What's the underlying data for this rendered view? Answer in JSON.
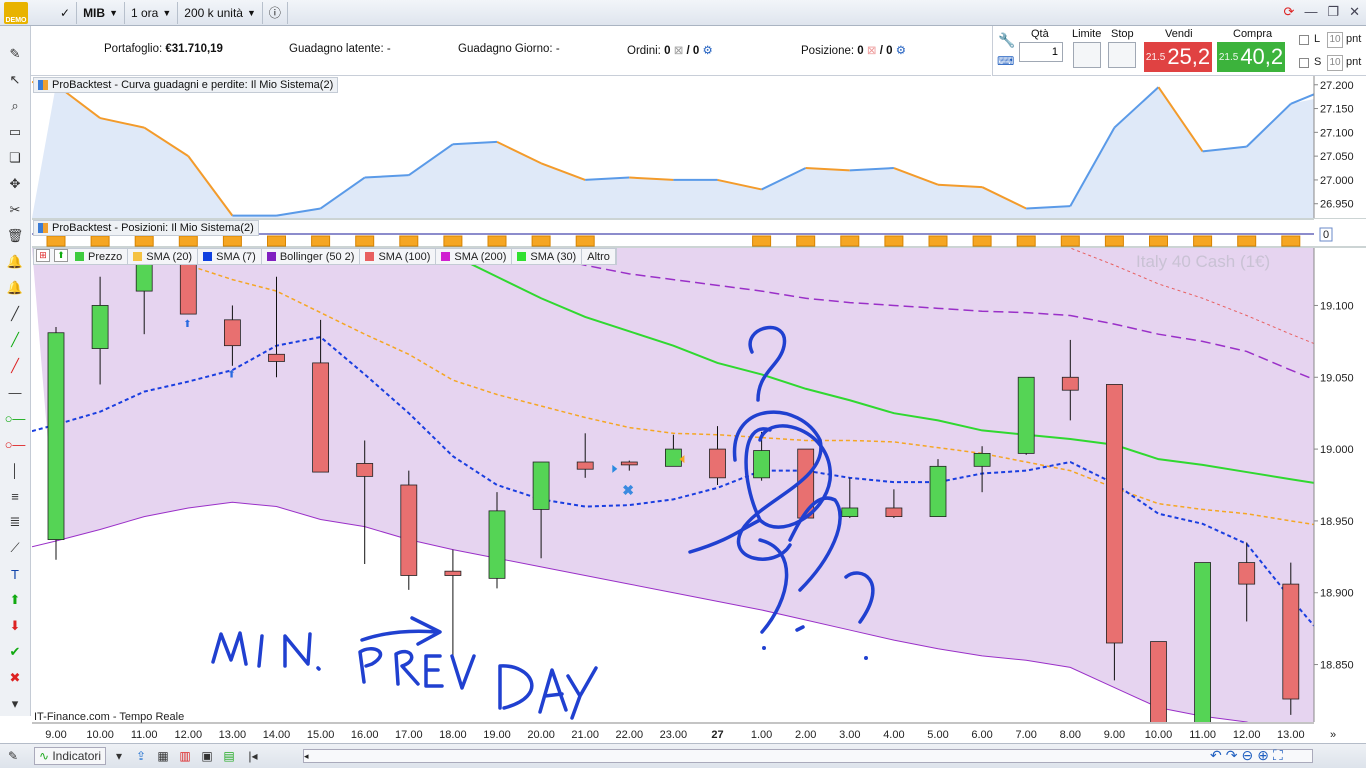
{
  "toolbar": {
    "demo_label": "DEMO",
    "instrument": "MIB",
    "timeframe": "1 ora",
    "units": "200 k unità",
    "info_icon": "info-icon"
  },
  "account": {
    "portfolio_label": "Portafoglio:",
    "portfolio_value": "€31.710,19",
    "latent_label": "Guadagno latente:",
    "latent_value": "-",
    "day_label": "Guadagno Giorno:",
    "day_value": "-",
    "orders_label": "Ordini:",
    "orders_value": "0",
    "orders_total": "/ 0",
    "position_label": "Posizione:",
    "position_value": "0",
    "position_total": "/ 0"
  },
  "order_panel": {
    "qty_label": "Qtà",
    "qty_value": "1",
    "limit_label": "Limite",
    "stop_label": "Stop",
    "sell_label": "Vendi",
    "buy_label": "Compra",
    "sell_small": "21.5",
    "sell_big": "25,2",
    "buy_small": "21.5",
    "buy_big": "40,2",
    "l_label": "L",
    "s_label": "S",
    "pnt_value": "10",
    "pnt_label": "pnt",
    "sell_color": "#e04242",
    "buy_color": "#3cb33c"
  },
  "panels": {
    "equity_title": "ProBacktest - Curva guadagni e perdite: Il Mio Sistema(2)",
    "positions_title": "ProBacktest - Posizioni: Il Mio Sistema(2)",
    "watermark": "Italy 40 Cash (1€)",
    "source": "IT-Finance.com - Tempo Reale",
    "positions_axis_value": "0"
  },
  "legend": [
    {
      "label": "Prezzo",
      "color": "#3ecb3e"
    },
    {
      "label": "SMA (20)",
      "color": "#f5c242"
    },
    {
      "label": "SMA (7)",
      "color": "#1040e0"
    },
    {
      "label": "Bollinger (50 2)",
      "color": "#8020c0"
    },
    {
      "label": "SMA (100)",
      "color": "#e86060"
    },
    {
      "label": "SMA (200)",
      "color": "#d020d0"
    },
    {
      "label": "SMA (30)",
      "color": "#30e030"
    },
    {
      "label": "Altro",
      "color": ""
    }
  ],
  "bottom": {
    "indicators_label": "Indicatori"
  },
  "annotation": {
    "text": "MIN. PREV DAY",
    "color": "#2040d0"
  },
  "chart_data": [
    {
      "type": "line",
      "name": "equity",
      "y_ticks": [
        "27.200",
        "27.150",
        "27.100",
        "27.050",
        "27.000",
        "26.950"
      ],
      "ylim": [
        26.92,
        27.21
      ],
      "x": [
        "9.00",
        "10.00",
        "11.00",
        "12.00",
        "13.00",
        "14.00",
        "15.00",
        "16.00",
        "17.00",
        "18.00",
        "19.00",
        "20.00",
        "21.00",
        "22.00",
        "23.00",
        "27",
        "1.00",
        "2.00",
        "3.00",
        "4.00",
        "5.00",
        "6.00",
        "7.00",
        "8.00",
        "9.00",
        "10.00",
        "11.00",
        "12.00",
        "13.00"
      ],
      "values": [
        27.2,
        27.13,
        27.11,
        27.05,
        26.925,
        26.925,
        26.94,
        27.005,
        27.01,
        27.075,
        27.08,
        27.035,
        27.0,
        27.005,
        27.0,
        27.0,
        26.98,
        27.025,
        27.02,
        27.025,
        26.99,
        26.985,
        26.94,
        26.945,
        27.11,
        27.195,
        27.06,
        27.07,
        27.16
      ]
    },
    {
      "type": "candlestick",
      "name": "Italy 40 Cash (1€)",
      "y_ticks": [
        "19.100",
        "19.050",
        "19.000",
        "18.950",
        "18.900",
        "18.850"
      ],
      "ylim": [
        18.81,
        19.14
      ],
      "x_ticks": [
        "9.00",
        "10.00",
        "11.00",
        "12.00",
        "13.00",
        "14.00",
        "15.00",
        "16.00",
        "17.00",
        "18.00",
        "19.00",
        "20.00",
        "21.00",
        "22.00",
        "23.00",
        "27",
        "1.00",
        "2.00",
        "3.00",
        "4.00",
        "5.00",
        "6.00",
        "7.00",
        "8.00",
        "9.00",
        "10.00",
        "11.00",
        "12.00",
        "13.00"
      ],
      "candles": [
        {
          "o": 18.937,
          "h": 19.085,
          "l": 18.923,
          "c": 19.081
        },
        {
          "o": 19.07,
          "h": 19.12,
          "l": 19.045,
          "c": 19.1
        },
        {
          "o": 19.11,
          "h": 19.15,
          "l": 19.08,
          "c": 19.15
        },
        {
          "o": 19.14,
          "h": 19.15,
          "l": 19.094,
          "c": 19.094
        },
        {
          "o": 19.09,
          "h": 19.1,
          "l": 19.058,
          "c": 19.072
        },
        {
          "o": 19.066,
          "h": 19.12,
          "l": 19.05,
          "c": 19.061
        },
        {
          "o": 19.06,
          "h": 19.09,
          "l": 18.984,
          "c": 18.984
        },
        {
          "o": 18.99,
          "h": 19.006,
          "l": 18.92,
          "c": 18.981
        },
        {
          "o": 18.975,
          "h": 18.985,
          "l": 18.902,
          "c": 18.912
        },
        {
          "o": 18.915,
          "h": 18.93,
          "l": 18.855,
          "c": 18.912
        },
        {
          "o": 18.91,
          "h": 18.97,
          "l": 18.903,
          "c": 18.957
        },
        {
          "o": 18.958,
          "h": 18.991,
          "l": 18.924,
          "c": 18.991
        },
        {
          "o": 18.991,
          "h": 19.011,
          "l": 18.98,
          "c": 18.986
        },
        {
          "o": 18.991,
          "h": 18.992,
          "l": 18.985,
          "c": 18.989
        },
        {
          "o": 18.988,
          "h": 19.01,
          "l": 18.988,
          "c": 19.0
        },
        {
          "o": 19.0,
          "h": 19.016,
          "l": 18.975,
          "c": 18.98
        },
        {
          "o": 18.98,
          "h": 19.012,
          "l": 18.978,
          "c": 18.999
        },
        {
          "o": 19.0,
          "h": 19.0,
          "l": 18.952,
          "c": 18.952
        },
        {
          "o": 18.953,
          "h": 18.98,
          "l": 18.952,
          "c": 18.959
        },
        {
          "o": 18.959,
          "h": 18.972,
          "l": 18.952,
          "c": 18.953
        },
        {
          "o": 18.953,
          "h": 18.993,
          "l": 18.953,
          "c": 18.988
        },
        {
          "o": 18.988,
          "h": 19.002,
          "l": 18.97,
          "c": 18.997
        },
        {
          "o": 18.997,
          "h": 19.05,
          "l": 18.996,
          "c": 19.05
        },
        {
          "o": 19.05,
          "h": 19.076,
          "l": 19.02,
          "c": 19.041
        },
        {
          "o": 19.045,
          "h": 19.045,
          "l": 18.839,
          "c": 18.865
        },
        {
          "o": 18.866,
          "h": 18.866,
          "l": 18.79,
          "c": 18.79
        },
        {
          "o": 18.79,
          "h": 18.921,
          "l": 18.79,
          "c": 18.921
        },
        {
          "o": 18.921,
          "h": 18.935,
          "l": 18.88,
          "c": 18.906
        },
        {
          "o": 18.906,
          "h": 18.921,
          "l": 18.815,
          "c": 18.826
        }
      ],
      "series": [
        {
          "name": "SMA (7)",
          "values": [
            19.017,
            19.026,
            19.04,
            19.047,
            19.055,
            19.072,
            19.078,
            19.052,
            19.025,
            18.995,
            18.975,
            18.965,
            18.96,
            18.961,
            18.965,
            18.973,
            18.985,
            18.985,
            18.98,
            18.977,
            18.977,
            18.983,
            18.985,
            18.991,
            18.976,
            18.955,
            18.948,
            18.934,
            18.896
          ]
        },
        {
          "name": "SMA (20)",
          "values": [
            19.18,
            19.17,
            19.15,
            19.128,
            19.118,
            19.11,
            19.095,
            19.08,
            19.066,
            19.048,
            19.038,
            19.03,
            19.022,
            19.015,
            19.011,
            19.01,
            19.008,
            19.006,
            19.006,
            19.005,
            19.001,
            18.997,
            18.991,
            18.985,
            18.973,
            18.962,
            18.958,
            18.955,
            18.95
          ]
        },
        {
          "name": "SMA (30)",
          "values": [
            19.21,
            19.205,
            19.2,
            19.195,
            19.19,
            19.18,
            19.17,
            19.16,
            19.15,
            19.135,
            19.12,
            19.105,
            19.092,
            19.082,
            19.072,
            19.06,
            19.052,
            19.042,
            19.034,
            19.025,
            19.02,
            19.013,
            19.01,
            19.007,
            19.003,
            18.993,
            18.989,
            18.984,
            18.979
          ]
        },
        {
          "name": "Bollinger (50 2) lower",
          "values": [
            18.936,
            18.944,
            18.953,
            18.959,
            18.963,
            18.96,
            18.951,
            18.946,
            18.937,
            18.93,
            18.924,
            18.918,
            18.912,
            18.906,
            18.9,
            18.894,
            18.888,
            18.881,
            18.874,
            18.867,
            18.861,
            18.856,
            18.853,
            18.848,
            18.834,
            18.82,
            18.814,
            18.81,
            18.8
          ]
        },
        {
          "name": "Bollinger (50 2) upper",
          "values": [
            19.24,
            19.23,
            19.22,
            19.21,
            19.2,
            19.195,
            19.185,
            19.175,
            19.165,
            19.155,
            19.145,
            19.135,
            19.128,
            19.122,
            19.118,
            19.114,
            19.11,
            19.105,
            19.102,
            19.1,
            19.098,
            19.096,
            19.095,
            19.093,
            19.087,
            19.08,
            19.075,
            19.068,
            19.055
          ]
        },
        {
          "name": "SMA (100)",
          "values": [
            19.3,
            19.295,
            19.29,
            19.285,
            19.28,
            19.275,
            19.27,
            19.265,
            19.26,
            19.255,
            19.25,
            19.245,
            19.24,
            19.232,
            19.225,
            19.218,
            19.21,
            19.2,
            19.19,
            19.18,
            19.17,
            19.16,
            19.15,
            19.14,
            19.128,
            19.115,
            19.105,
            19.093,
            19.08
          ]
        }
      ]
    }
  ]
}
